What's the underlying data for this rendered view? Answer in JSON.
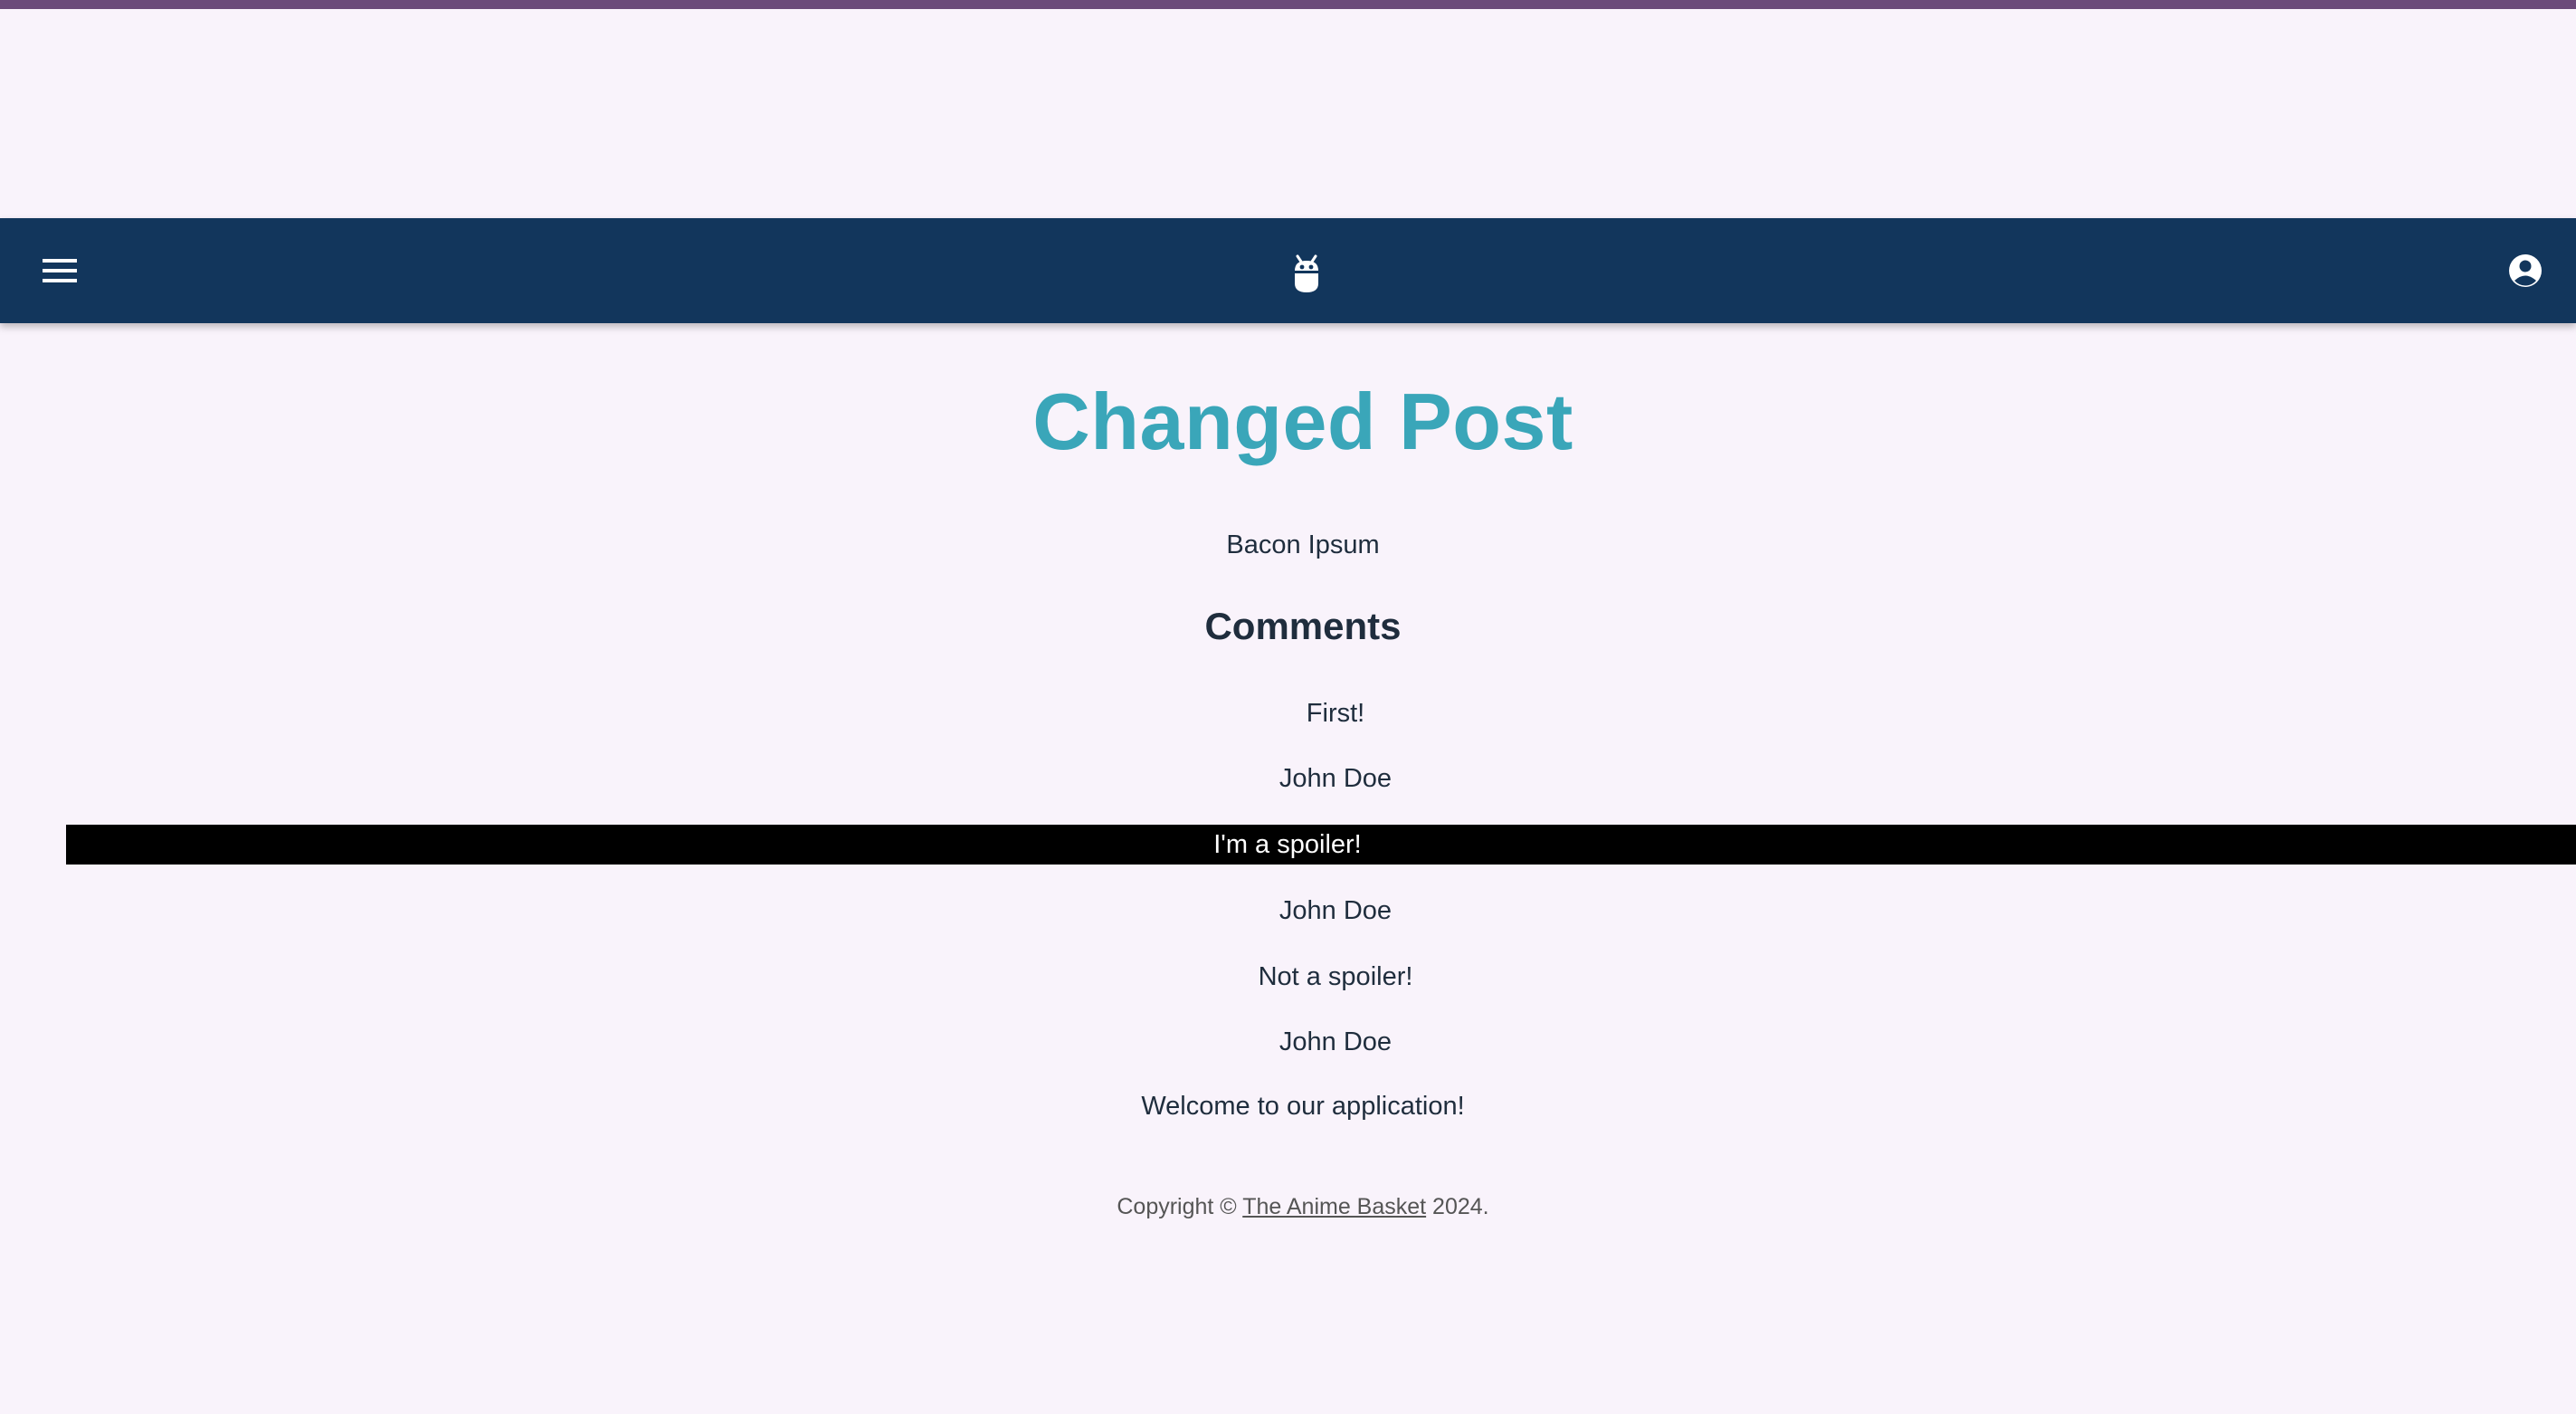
{
  "app_bar": {
    "menu_icon": "hamburger-menu-icon",
    "logo_icon": "bot-logo-icon",
    "account_icon": "account-circle-icon",
    "colors": {
      "top_strip": "#6b4b7a",
      "bar": "#12365c"
    }
  },
  "post": {
    "title": "Changed Post",
    "body": "Bacon Ipsum",
    "title_color": "#3aa6b9"
  },
  "comments": {
    "heading": "Comments",
    "items": [
      {
        "text": "First!",
        "author": "John Doe",
        "spoiler": false
      },
      {
        "text": "I'm a spoiler!",
        "author": "John Doe",
        "spoiler": true
      },
      {
        "text": "Not a spoiler!",
        "author": "John Doe",
        "spoiler": false
      }
    ]
  },
  "welcome": "Welcome to our application!",
  "footer": {
    "prefix": "Copyright © ",
    "link": "The Anime Basket",
    "suffix": " 2024."
  }
}
